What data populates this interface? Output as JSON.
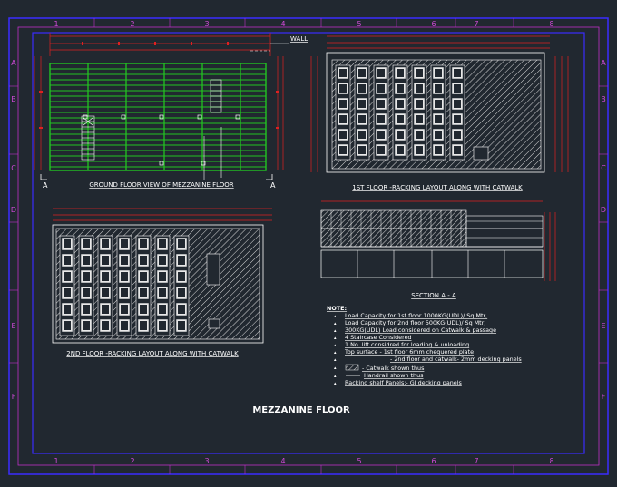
{
  "grid": {
    "columns": [
      "1",
      "2",
      "3",
      "4",
      "5",
      "6",
      "7",
      "8"
    ],
    "rows": [
      "A",
      "B",
      "C",
      "D",
      "E",
      "F"
    ]
  },
  "views": {
    "ground_floor": "GROUND FLOOR VIEW OF MEZZANINE FLOOR",
    "first_floor": "1ST FLOOR -RACKING LAYOUT ALONG WITH CATWALK",
    "second_floor": "2ND FLOOR -RACKING LAYOUT ALONG WITH CATWALK",
    "section": "SECTION  A - A",
    "wall": "WALL",
    "section_marker": "A"
  },
  "notes": {
    "heading": "NOTE:",
    "items": [
      "Load Capacity for 1st floor 1000KG(UDL)/ Sq Mtr,",
      "Load Capacity for 2nd floor 500KG(UDL)/ Sq Mtr,",
      "300KG(UDL) Load considered on Catwalk & passage",
      "4 Staircase Considered",
      "1 No. lift considred for loading & unloading",
      "Top surface - 1st floor 6mm chequered plate",
      "- 2nd floor and catwalk- 2mm decking panels"
    ],
    "legend": [
      "- Catwalk  shown  thus",
      "Handrail shown thus",
      "Racking shelf Panels:- GI decking panels"
    ]
  },
  "drawing_title": "MEZZANINE FLOOR",
  "colors": {
    "background": "#212830",
    "border": "#3a2cff",
    "grid_label": "#d04ad8",
    "dimension": "#e02020",
    "ground_floor": "#22c322",
    "hatch": "#d8d8d8"
  }
}
